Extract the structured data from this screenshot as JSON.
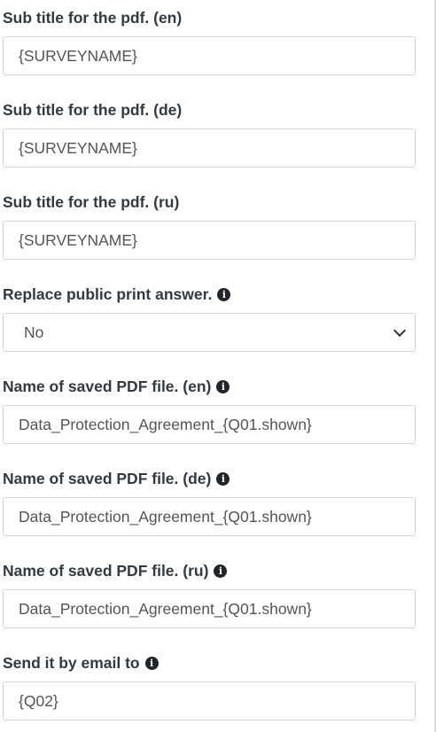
{
  "fields": {
    "subtitle_en": {
      "label": "Sub title for the pdf. (en)",
      "value": "{SURVEYNAME}"
    },
    "subtitle_de": {
      "label": "Sub title for the pdf. (de)",
      "value": "{SURVEYNAME}"
    },
    "subtitle_ru": {
      "label": "Sub title for the pdf. (ru)",
      "value": "{SURVEYNAME}"
    },
    "replace_print": {
      "label": "Replace public print answer.",
      "value": "No",
      "icon": "info-icon"
    },
    "pdf_name_en": {
      "label": "Name of saved PDF file. (en)",
      "value": "Data_Protection_Agreement_{Q01.shown}",
      "icon": "info-icon"
    },
    "pdf_name_de": {
      "label": "Name of saved PDF file. (de)",
      "value": "Data_Protection_Agreement_{Q01.shown}",
      "icon": "info-icon"
    },
    "pdf_name_ru": {
      "label": "Name of saved PDF file. (ru)",
      "value": "Data_Protection_Agreement_{Q01.shown}",
      "icon": "info-icon"
    },
    "email_to": {
      "label": "Send it by email to",
      "value": "{Q02}",
      "icon": "info-icon"
    }
  }
}
